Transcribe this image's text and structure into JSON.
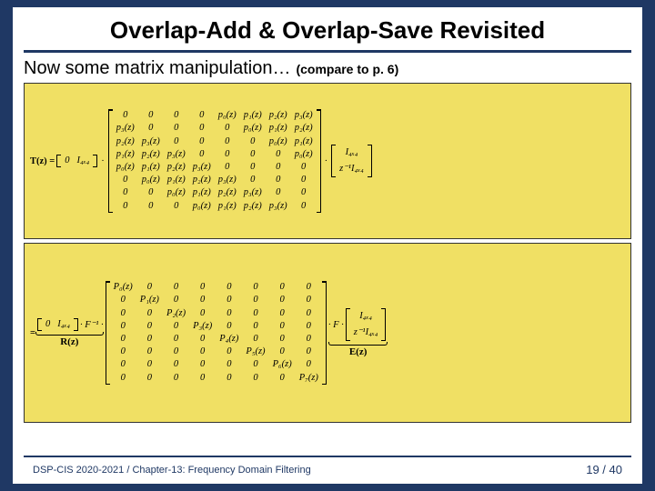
{
  "title": "Overlap-Add & Overlap-Save Revisited",
  "subtitle": "Now some matrix manipulation…",
  "note": "(compare to p. 6)",
  "footer": {
    "left": "DSP-CIS 2020-2021 / Chapter-13: Frequency Domain Filtering",
    "page_current": "19",
    "page_sep": " / ",
    "page_total": "40"
  },
  "eq1": {
    "lhs": "T(z) =",
    "row_pre": [
      "0",
      "I₄ₓ₄"
    ],
    "dot": "·",
    "main": [
      [
        "0",
        "0",
        "0",
        "0",
        "p₀(z)",
        "p₁(z)",
        "p₂(z)",
        "p₃(z)"
      ],
      [
        "p₃(z)",
        "0",
        "0",
        "0",
        "0",
        "p₀(z)",
        "p₁(z)",
        "p₂(z)"
      ],
      [
        "p₂(z)",
        "p₃(z)",
        "0",
        "0",
        "0",
        "0",
        "p₀(z)",
        "p₁(z)"
      ],
      [
        "p₁(z)",
        "p₂(z)",
        "p₃(z)",
        "0",
        "0",
        "0",
        "0",
        "p₀(z)"
      ],
      [
        "p₀(z)",
        "p₁(z)",
        "p₂(z)",
        "p₃(z)",
        "0",
        "0",
        "0",
        "0"
      ],
      [
        "0",
        "p₀(z)",
        "p₁(z)",
        "p₂(z)",
        "p₃(z)",
        "0",
        "0",
        "0"
      ],
      [
        "0",
        "0",
        "p₀(z)",
        "p₁(z)",
        "p₂(z)",
        "p₃(z)",
        "0",
        "0"
      ],
      [
        "0",
        "0",
        "0",
        "p₀(z)",
        "p₁(z)",
        "p₂(z)",
        "p₃(z)",
        "0"
      ]
    ],
    "col": [
      "I₄ₓ₄",
      "z⁻¹I₄ₓ₄"
    ]
  },
  "eq2": {
    "lhs": "=",
    "row_pre": [
      "0",
      "I₄ₓ₄"
    ],
    "suffix1": "· F⁻¹ ·",
    "diag": [
      [
        "P₀(z)",
        "0",
        "0",
        "0",
        "0",
        "0",
        "0",
        "0"
      ],
      [
        "0",
        "P₁(z)",
        "0",
        "0",
        "0",
        "0",
        "0",
        "0"
      ],
      [
        "0",
        "0",
        "P₂(z)",
        "0",
        "0",
        "0",
        "0",
        "0"
      ],
      [
        "0",
        "0",
        "0",
        "P₃(z)",
        "0",
        "0",
        "0",
        "0"
      ],
      [
        "0",
        "0",
        "0",
        "0",
        "P₄(z)",
        "0",
        "0",
        "0"
      ],
      [
        "0",
        "0",
        "0",
        "0",
        "0",
        "P₅(z)",
        "0",
        "0"
      ],
      [
        "0",
        "0",
        "0",
        "0",
        "0",
        "0",
        "P₆(z)",
        "0"
      ],
      [
        "0",
        "0",
        "0",
        "0",
        "0",
        "0",
        "0",
        "P₇(z)"
      ]
    ],
    "suffix2": "· F ·",
    "col": [
      "I₄ₓ₄",
      "z⁻¹I₄ₓ₄"
    ],
    "annot_R": "R(z)",
    "annot_E": "E(z)"
  }
}
